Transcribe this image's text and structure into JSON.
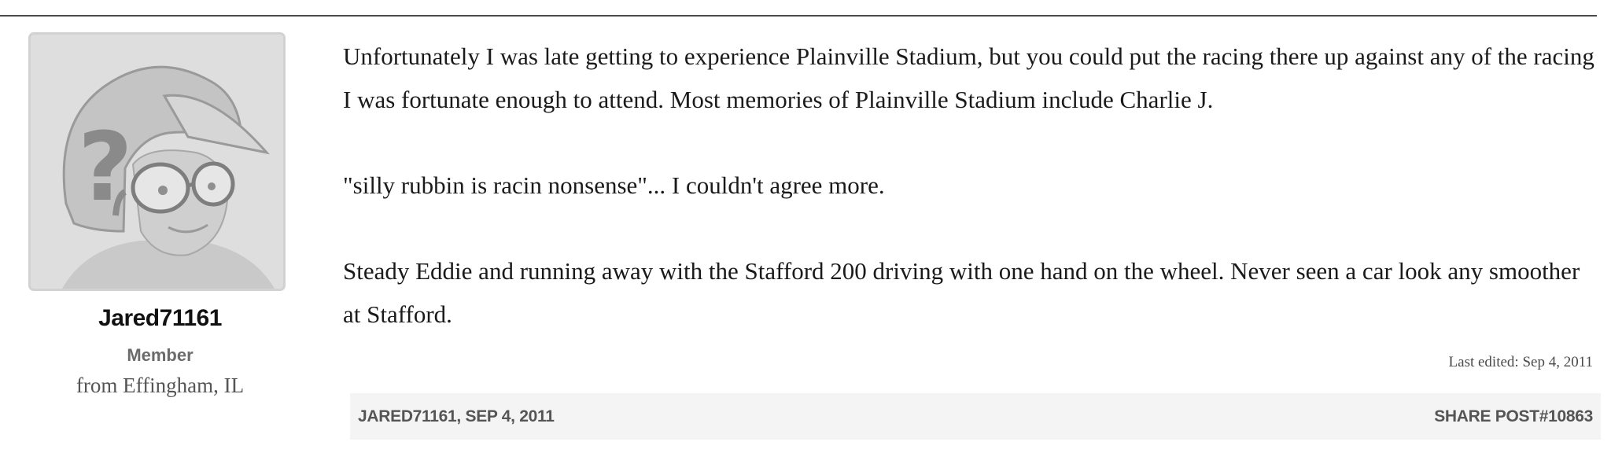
{
  "author": {
    "username": "Jared71161",
    "title": "Member",
    "location": "from Effingham, IL",
    "avatar_icon": "racing-helmet-avatar-icon"
  },
  "post": {
    "paragraphs": [
      "Unfortunately I was late getting to experience Plainville Stadium, but you could put the racing there up against any of the racing I was fortunate enough to attend. Most memories of Plainville Stadium include Charlie J.",
      "\"silly rubbin is racin nonsense\"... I couldn't agree more.",
      "Steady Eddie and running away with the Stafford 200 driving with one hand on the wheel. Never seen a car look any smoother at Stafford."
    ],
    "last_edited": "Last edited: Sep 4, 2011",
    "byline": "JARED71161, SEP 4, 2011",
    "share_label": "SHARE POST#10863"
  },
  "colors": {
    "divider": "#4a4a4a",
    "footer_background": "#f4f4f4",
    "meta_text": "#555555"
  }
}
